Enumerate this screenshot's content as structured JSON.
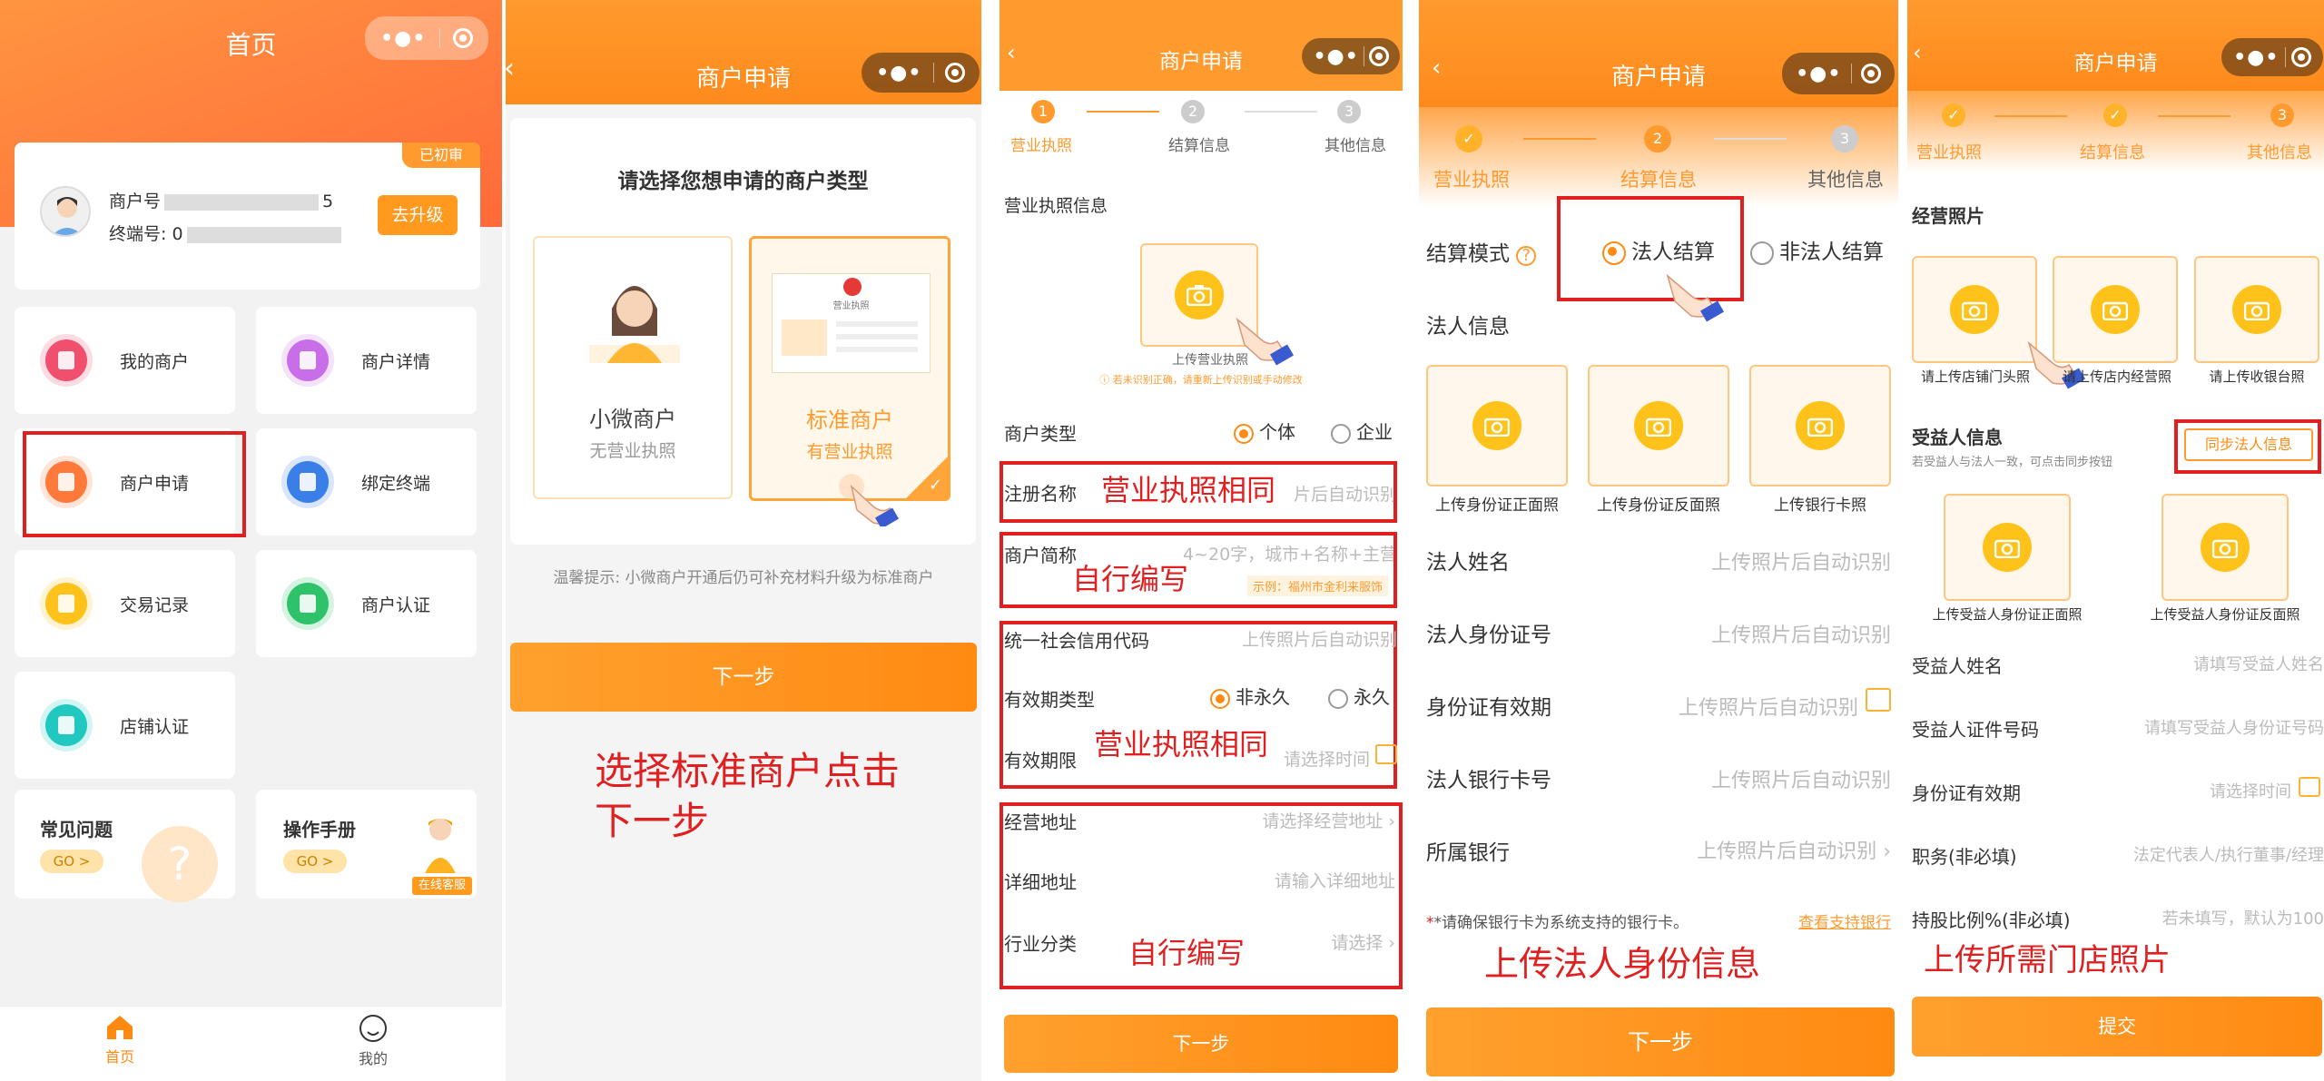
{
  "p1": {
    "title": "首页",
    "badge": "已初审",
    "merchant_no_label": "商户号",
    "merchant_no_suffix": "5",
    "terminal_label": "终端号: 0",
    "upgrade": "去升级",
    "menu": [
      {
        "label": "我的商户",
        "icon": "home-icon",
        "color": "#f0506e"
      },
      {
        "label": "商户详情",
        "icon": "card-icon",
        "color": "#c86ee8"
      },
      {
        "label": "商户申请",
        "icon": "apply-icon",
        "color": "#ff7a3a"
      },
      {
        "label": "绑定终端",
        "icon": "terminal-icon",
        "color": "#3a7ee8"
      },
      {
        "label": "交易记录",
        "icon": "record-icon",
        "color": "#ffc21a"
      },
      {
        "label": "商户认证",
        "icon": "verify-icon",
        "color": "#2ec36a"
      },
      {
        "label": "店铺认证",
        "icon": "shop-icon",
        "color": "#20c8c0"
      }
    ],
    "faq": "常见问题",
    "faq_go": "GO >",
    "manual": "操作手册",
    "manual_go": "GO >",
    "online": "在线客服",
    "tab_home": "首页",
    "tab_mine": "我的"
  },
  "p2": {
    "title": "商户申请",
    "heading": "请选择您想申请的商户类型",
    "type1": "小微商户",
    "type1_sub": "无营业执照",
    "type2": "标准商户",
    "type2_sub": "有营业执照",
    "license_tag": "营业执照",
    "tip": "温馨提示: 小微商户开通后仍可补充材料升级为标准商户",
    "next": "下一步",
    "anno": "选择标准商户点击\n下一步"
  },
  "p3": {
    "title": "商户申请",
    "steps": [
      "营业执照",
      "结算信息",
      "其他信息"
    ],
    "section": "营业执照信息",
    "upload_caption": "上传营业执照",
    "warn": "若未识别正确，请重新上传识别或手动修改",
    "merchant_type": "商户类型",
    "opt_person": "个体",
    "opt_company": "企业",
    "reg_name": "注册名称",
    "reg_name_ph": "片后自动识别",
    "anno_same1": "营业执照相同",
    "short_name": "商户简称",
    "short_name_ph": "4~20字，城市+名称+主营",
    "anno_self1": "自行编写",
    "example": "示例：福州市金利来服饰",
    "credit_code": "统一社会信用代码",
    "credit_code_ph": "上传照片后自动识别",
    "valid_type": "有效期类型",
    "opt_nonperm": "非永久",
    "opt_perm": "永久",
    "valid_period": "有效期限",
    "valid_period_ph": "请选择时间",
    "anno_same2": "营业执照相同",
    "address": "经营地址",
    "address_ph": "请选择经营地址",
    "detail_address": "详细地址",
    "detail_address_ph": "请输入详细地址",
    "industry": "行业分类",
    "industry_ph": "请选择",
    "anno_self2": "自行编写",
    "next": "下一步"
  },
  "p4": {
    "title": "商户申请",
    "steps": [
      "营业执照",
      "结算信息",
      "其他信息"
    ],
    "settle_mode": "结算模式",
    "opt_legal": "法人结算",
    "opt_nonlegal": "非法人结算",
    "legal_info": "法人信息",
    "uploads": [
      "上传身份证正面照",
      "上传身份证反面照",
      "上传银行卡照"
    ],
    "legal_name": "法人姓名",
    "legal_name_ph": "上传照片后自动识别",
    "legal_id": "法人身份证号",
    "legal_id_ph": "上传照片后自动识别",
    "id_valid": "身份证有效期",
    "id_valid_ph": "上传照片后自动识别",
    "bank_card": "法人银行卡号",
    "bank_card_ph": "上传照片后自动识别",
    "bank": "所属银行",
    "bank_ph": "上传照片后自动识别",
    "bank_note": "*请确保银行卡为系统支持的银行卡。",
    "bank_link": "查看支持银行",
    "anno": "上传法人身份信息",
    "next": "下一步"
  },
  "p5": {
    "title": "商户申请",
    "steps": [
      "营业执照",
      "结算信息",
      "其他信息"
    ],
    "section": "经营照片",
    "uploads": [
      "请上传店铺门头照",
      "请上传店内经营照",
      "请上传收银台照"
    ],
    "beneficiary": "受益人信息",
    "beneficiary_note": "若受益人与法人一致，可点击同步按钮",
    "sync": "同步法人信息",
    "id_uploads": [
      "上传受益人身份证正面照",
      "上传受益人身份证反面照"
    ],
    "ben_name": "受益人姓名",
    "ben_name_ph": "请填写受益人姓名",
    "ben_id": "受益人证件号码",
    "ben_id_ph": "请填写受益人身份证号码",
    "id_valid": "身份证有效期",
    "id_valid_ph": "请选择时间",
    "job": "职务(非必填)",
    "job_ph": "法定代表人/执行董事/经理",
    "share": "持股比例%(非必填)",
    "share_ph": "若未填写，默认为100",
    "anno": "上传所需门店照片",
    "submit": "提交"
  },
  "colors": {
    "orange": "#ff8a12",
    "red": "#e02020"
  }
}
